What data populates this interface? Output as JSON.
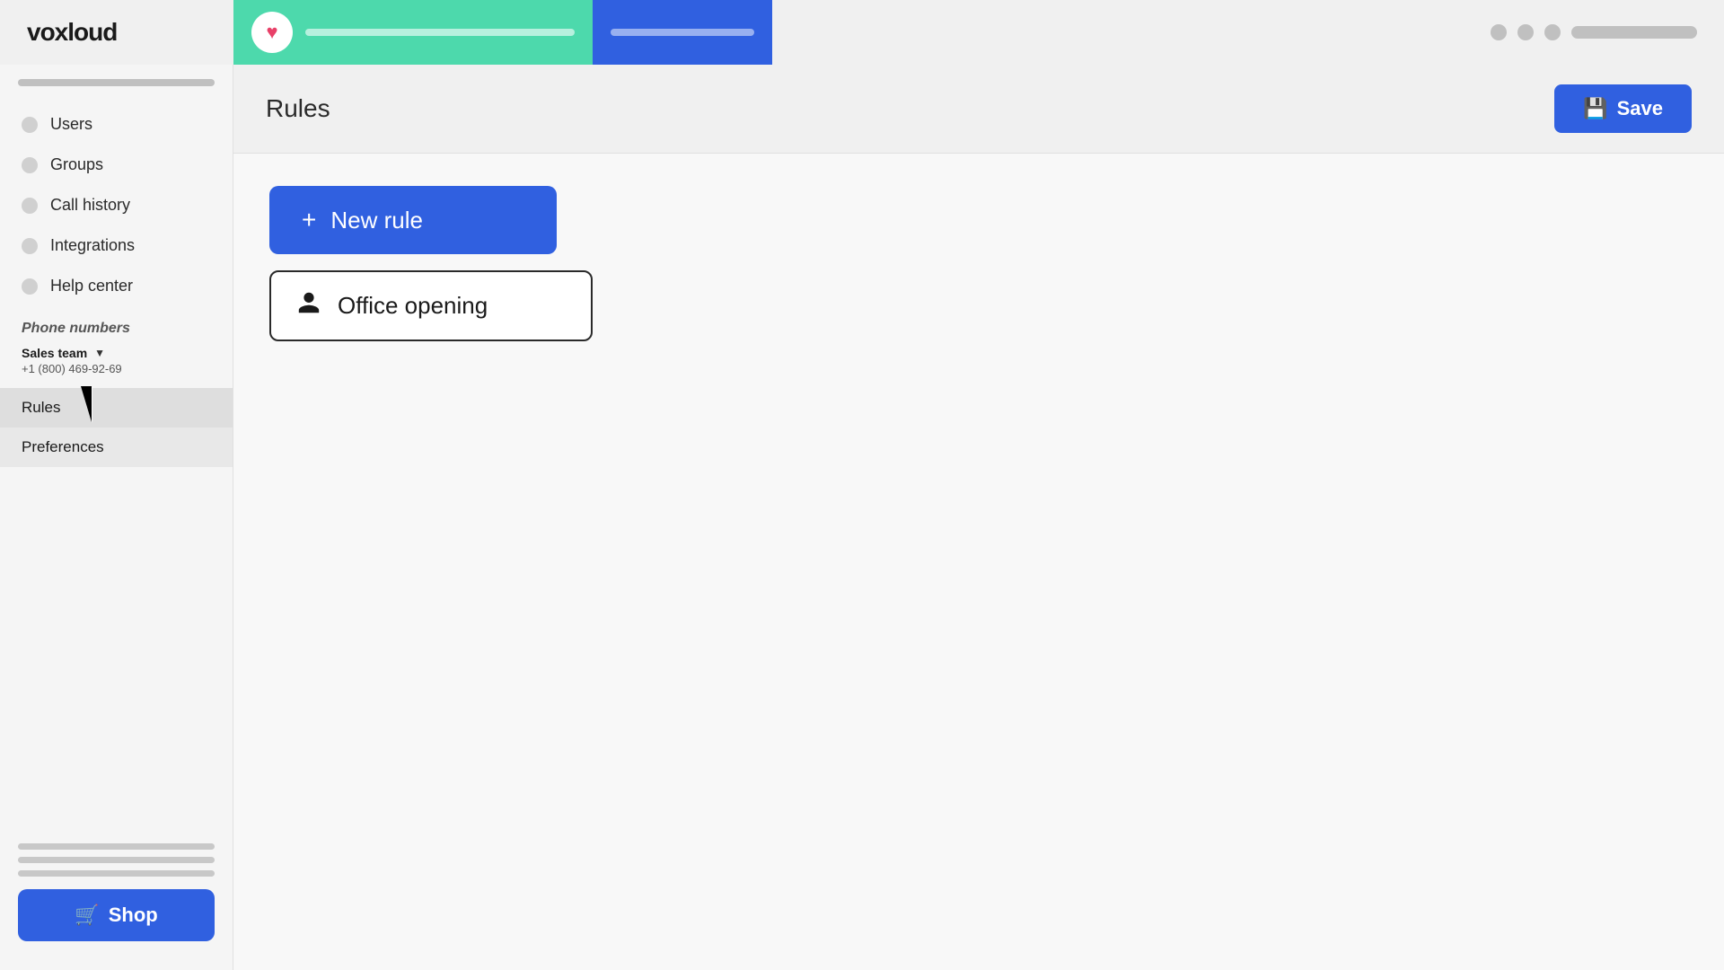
{
  "brand": {
    "name": "voxloud"
  },
  "topbar": {
    "dots": [
      "dot1",
      "dot2",
      "dot3"
    ]
  },
  "sidebar": {
    "nav_items": [
      {
        "label": "Users",
        "id": "users"
      },
      {
        "label": "Groups",
        "id": "groups"
      },
      {
        "label": "Call history",
        "id": "call-history"
      },
      {
        "label": "Integrations",
        "id": "integrations"
      },
      {
        "label": "Help center",
        "id": "help-center"
      }
    ],
    "phone_numbers_title": "Phone numbers",
    "team_name": "Sales team",
    "phone_number": "+1 (800) 469-92-69",
    "sub_items": [
      {
        "label": "Rules",
        "id": "rules",
        "active": true
      },
      {
        "label": "Preferences",
        "id": "preferences",
        "active": false
      }
    ],
    "shop_label": "Shop"
  },
  "main": {
    "page_title": "Rules",
    "save_button_label": "Save",
    "new_rule_label": "New rule",
    "office_opening_label": "Office opening"
  }
}
